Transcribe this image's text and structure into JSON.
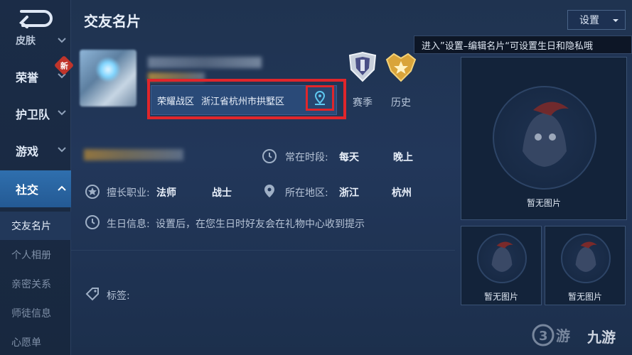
{
  "header": {
    "title": "交友名片",
    "settings_label": "设置"
  },
  "tooltip": {
    "text": "进入”设置–编辑名片“可设置生日和隐私哦"
  },
  "sidebar": {
    "partial_item": "皮肤",
    "items": [
      {
        "label": "荣誉",
        "badge": "新"
      },
      {
        "label": "护卫队"
      },
      {
        "label": "游戏"
      },
      {
        "label": "社交"
      }
    ],
    "sub_items": [
      {
        "label": "交友名片"
      },
      {
        "label": "个人相册"
      },
      {
        "label": "亲密关系"
      },
      {
        "label": "师徒信息"
      },
      {
        "label": "心愿单"
      }
    ]
  },
  "profile": {
    "zone": "荣耀战区",
    "city": "浙江省杭州市拱墅区",
    "badges": [
      {
        "label": "赛季",
        "icon": "season-rank-icon"
      },
      {
        "label": "历史",
        "icon": "history-rank-icon"
      }
    ]
  },
  "info": {
    "online_label": "常在时段:",
    "online_values": [
      "每天",
      "晚上"
    ],
    "role_label": "擅长职业:",
    "role_values": [
      "法师",
      "战士"
    ],
    "region_label": "所在地区:",
    "region_values": [
      "浙江",
      "杭州"
    ],
    "birthday_label": "生日信息:",
    "birthday_text": "设置后，在您生日时好友会在礼物中心收到提示",
    "tag_label": "标签:"
  },
  "photos": {
    "empty_label": "暂无图片"
  },
  "colors": {
    "highlight": "#e0262b",
    "active_tab": "#2f6fae",
    "background": "#22375a"
  }
}
